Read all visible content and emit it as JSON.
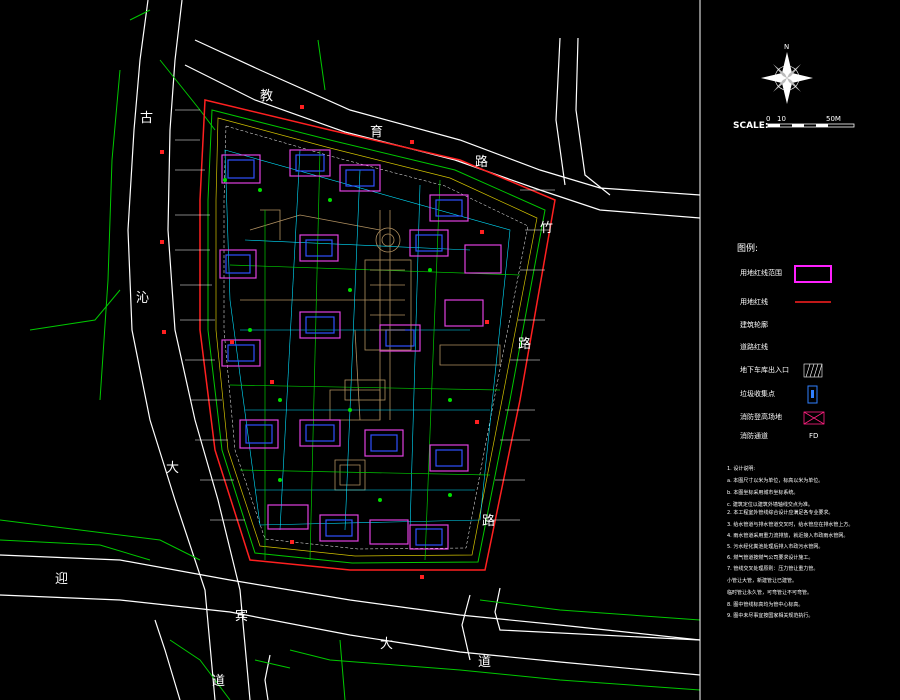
{
  "colors": {
    "background": "#000000",
    "road_white": "#ffffff",
    "road_green": "#00c800",
    "boundary_red": "#ff2020",
    "building_magenta": "#e040e0",
    "building_blue": "#3050ff",
    "pipe_cyan": "#00e0ff",
    "landscape_yellow": "#d0c000"
  },
  "roads": {
    "west_road": [
      "古",
      "沁",
      "大",
      "道"
    ],
    "north_road": [
      "教",
      "育",
      "路"
    ],
    "south_road": [
      "迎",
      "宾",
      "大",
      "道"
    ],
    "east_road": [
      "竹",
      "路",
      "路"
    ]
  },
  "legend_panel": {
    "north_arrow_letter": "N",
    "scale_label": "SCALE:",
    "scale_ticks": [
      "0",
      "10",
      "50M"
    ],
    "legend_title": "图例:",
    "items": [
      {
        "label": "用地红线范围",
        "symbol": "magenta-rectangle",
        "color": "#ff20ff"
      },
      {
        "label": "用地红线",
        "symbol": "red-line",
        "color": "#ff2020"
      },
      {
        "label": "建筑轮廓",
        "symbol": "none",
        "color": "#ffffff"
      },
      {
        "label": "道路红线",
        "symbol": "none",
        "color": "#ffffff"
      },
      {
        "label": "地下车库出入口",
        "symbol": "hatched-box",
        "color": "#ffffff"
      },
      {
        "label": "垃圾收集点",
        "symbol": "blue-box",
        "color": "#3080ff"
      },
      {
        "label": "消防登高场地",
        "symbol": "crossed-box",
        "color": "#ff2080"
      },
      {
        "label": "消防通道",
        "symbol": "text-fd",
        "color": "#ffffff"
      }
    ],
    "legend_fd_text": "FD"
  },
  "notes": [
    "1. 设计说明:",
    "  a. 本图尺寸以米为单位，标高以米为单位。",
    "  b. 本图坐标采用城市坐标系统。",
    "  c. 建筑定位以建筑外墙轴线交点为准。",
    "2. 本工程室外管线综合设计应满足各专业要求。",
    "3. 给水管道与排水管道交叉时，给水管应在排水管上方。",
    "4. 雨水管道采用重力流排放，就近接入市政雨水管网。",
    "5. 污水经化粪池处理后排入市政污水管网。",
    "6. 燃气管道按燃气公司要求设计施工。",
    "7. 管线交叉处理原则：压力管让重力管。",
    "  小管让大管，新建管让已建管。",
    "  临时管让永久管，可弯管让不可弯管。",
    "8. 图中管线标高均为管中心标高。",
    "9. 图中未尽事宜按国家相关规范执行。"
  ]
}
